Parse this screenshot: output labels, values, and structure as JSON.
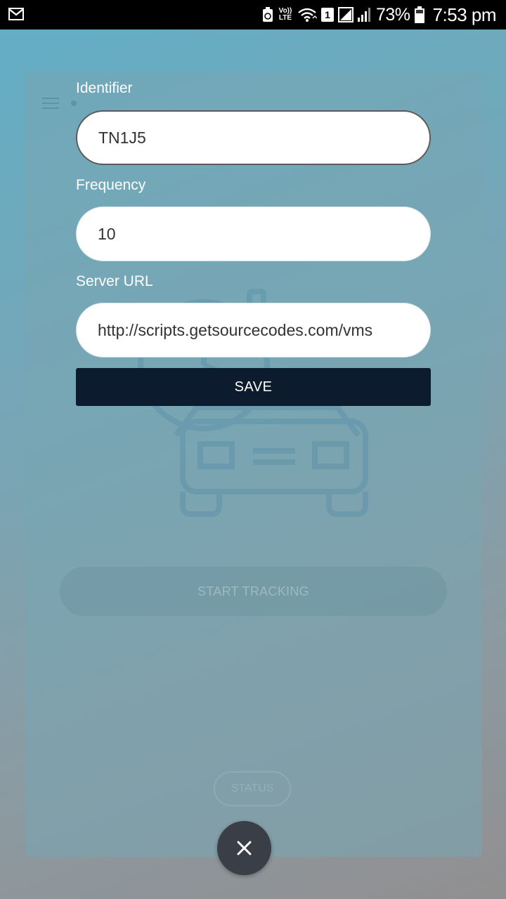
{
  "status_bar": {
    "battery_percent": "73%",
    "time": "7:53 pm",
    "volte_label": "Vo))\nLTE",
    "sim_slot": "1",
    "icons": [
      "gmail-icon",
      "recycle-icon",
      "volte-icon",
      "wifi-icon",
      "sim-icon",
      "signal-icon",
      "battery-icon"
    ]
  },
  "form": {
    "identifier": {
      "label": "Identifier",
      "value": "TN1J5"
    },
    "frequency": {
      "label": "Frequency",
      "value": "10"
    },
    "server_url": {
      "label": "Server URL",
      "value": "http://scripts.getsourcecodes.com/vms"
    },
    "save_label": "SAVE"
  },
  "background": {
    "start_tracking_label": "START TRACKING",
    "status_label": "STATUS",
    "icons": [
      "menu-icon",
      "car-tracking-icon"
    ]
  },
  "fab": {
    "icon": "close-icon"
  },
  "colors": {
    "save_button": "#0d1b2e",
    "fab": "#3a3f47",
    "background_top": "#62aec6",
    "background_bottom": "#918f90"
  }
}
